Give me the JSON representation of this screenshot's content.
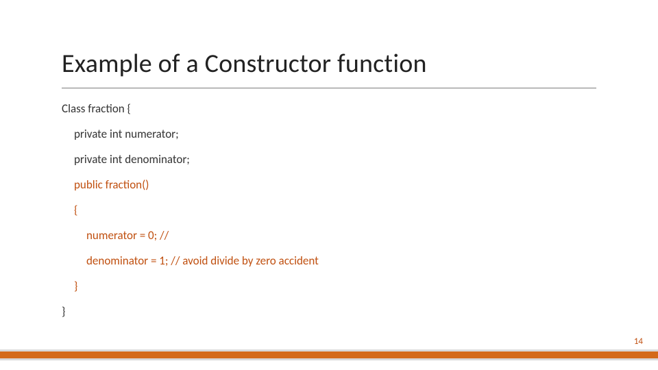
{
  "title": "Example of a Constructor function",
  "code": {
    "l1": "Class fraction {",
    "l2": "private int numerator;",
    "l3": "private int denominator;",
    "l4": "public fraction()",
    "l5": "{",
    "l6": "numerator = 0;      //",
    "l7": "denominator = 1;  // avoid divide by zero accident",
    "l8": "}",
    "l9": "}"
  },
  "page_number": "14"
}
